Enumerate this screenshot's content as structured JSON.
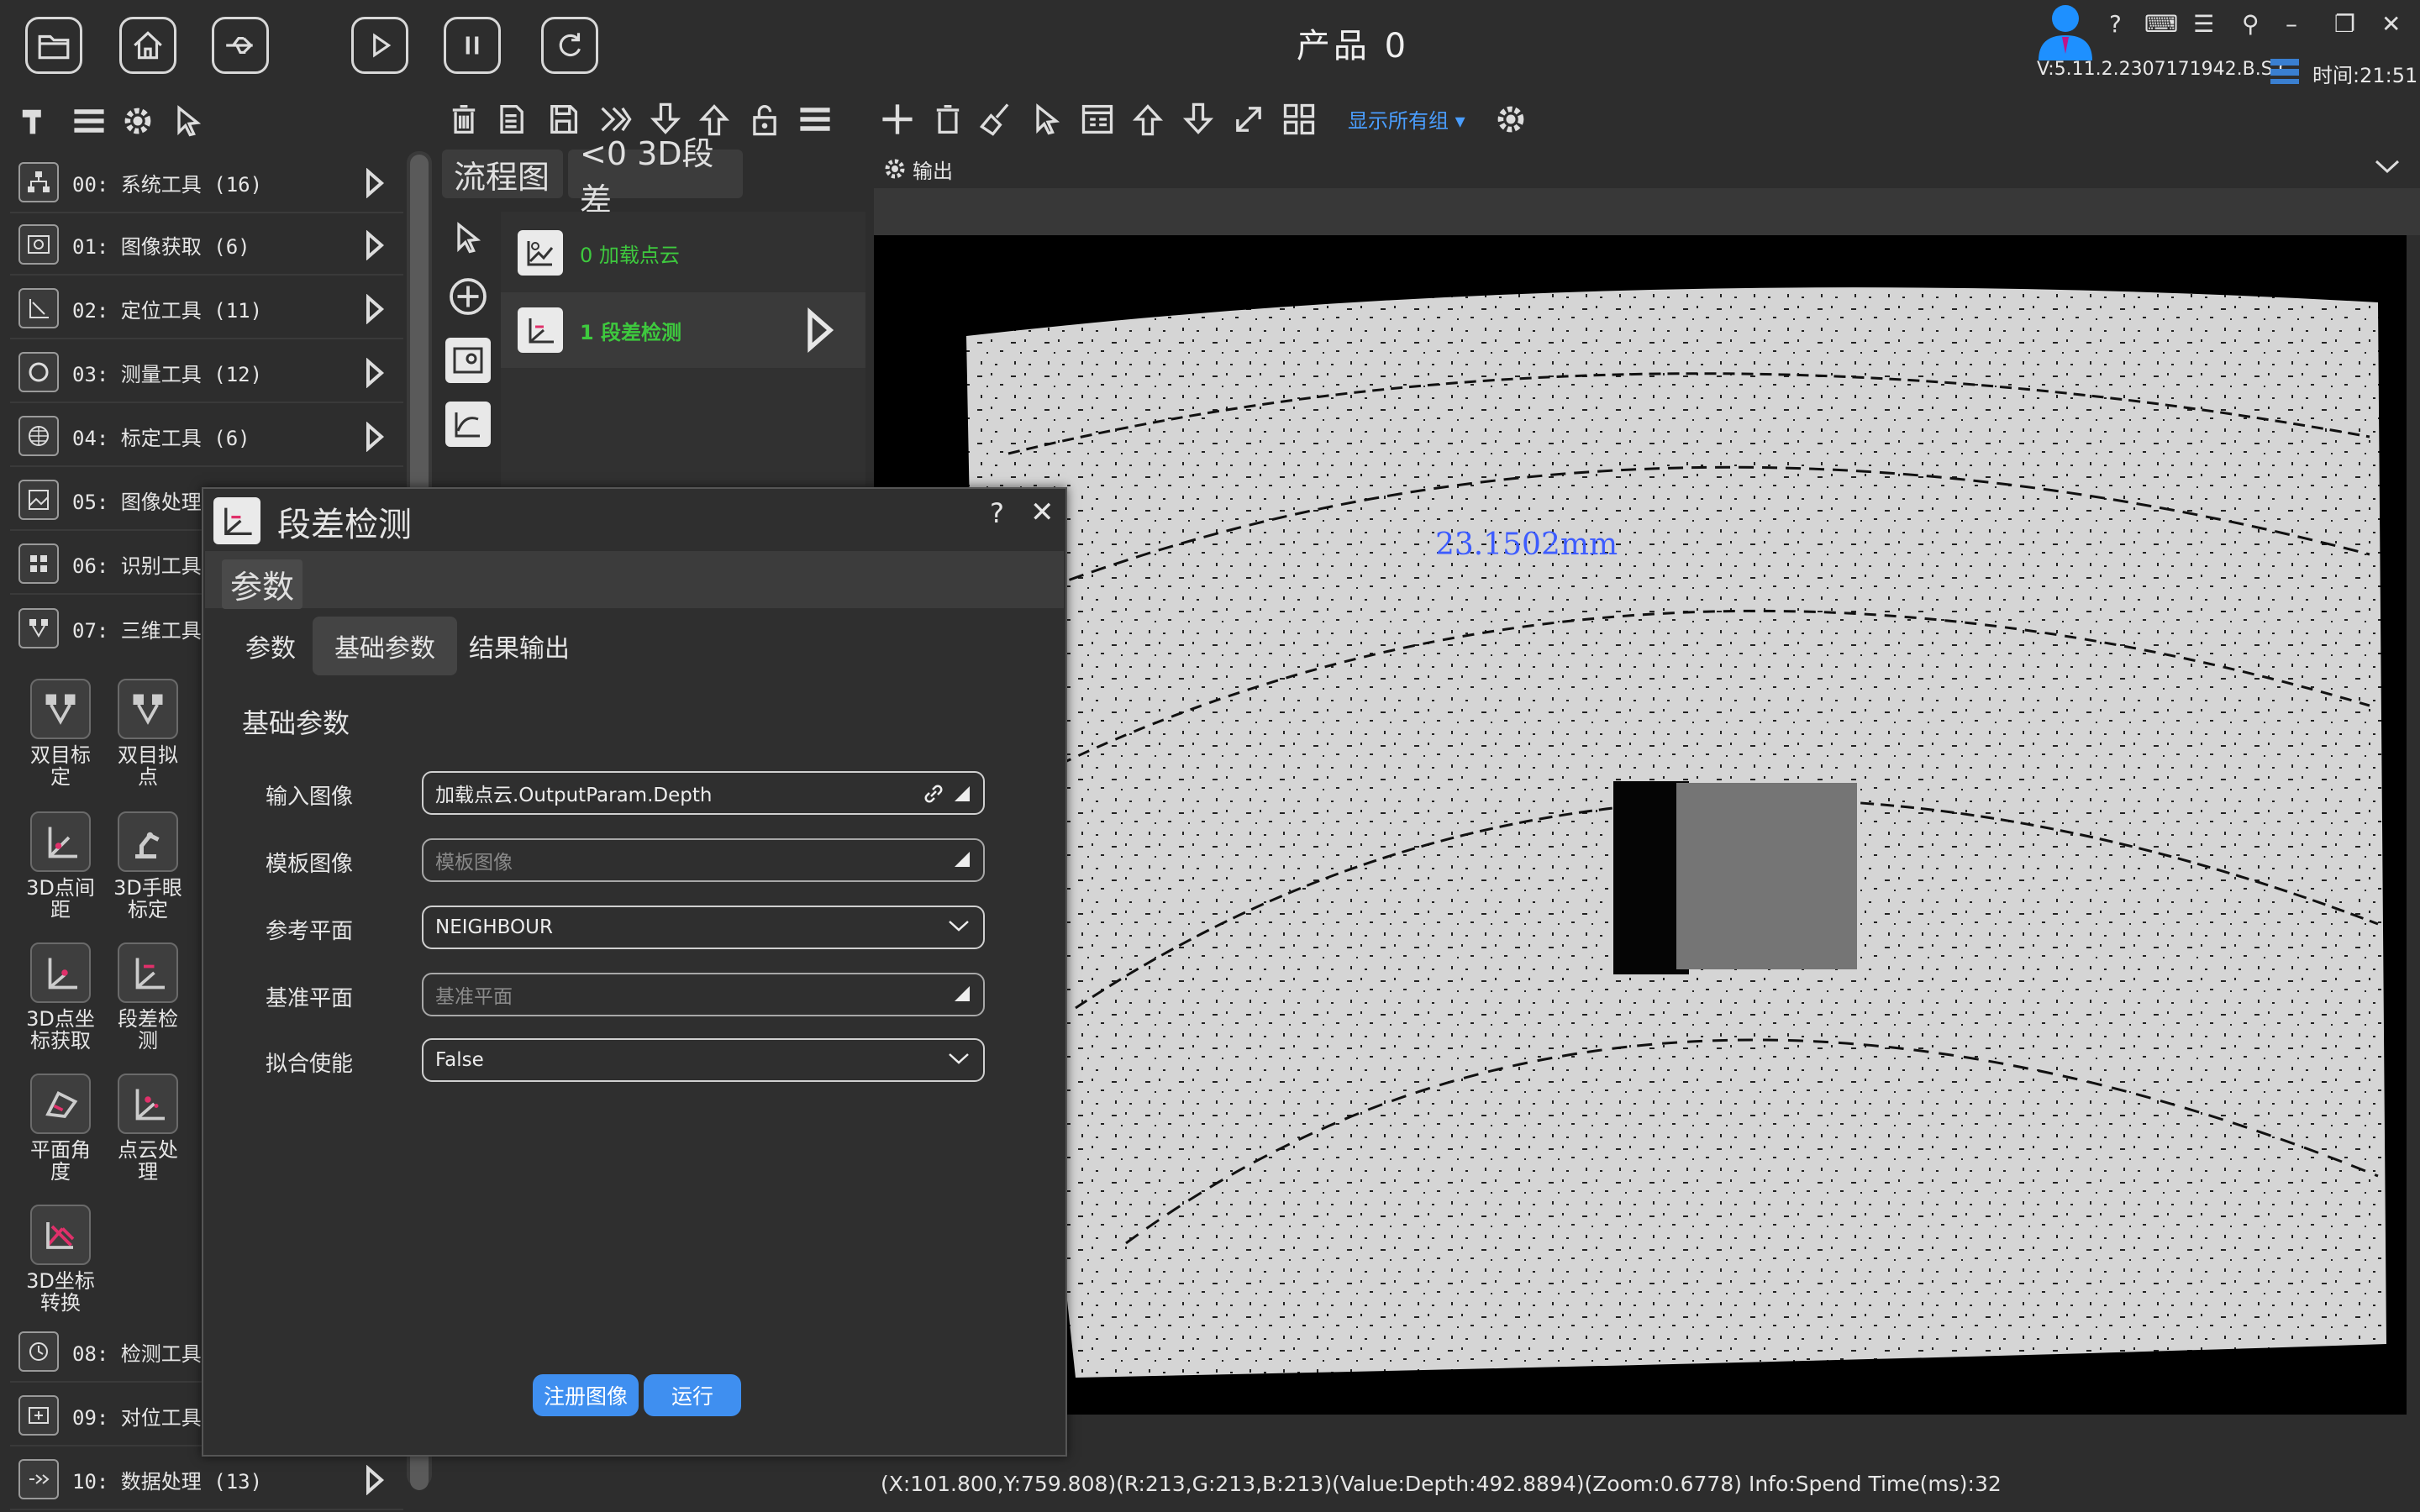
{
  "titlebar": {
    "product_title": "产品 0",
    "version": "V:5.11.2.2307171942.B.S.C.",
    "time": "时间:21:51"
  },
  "toolbar": {
    "show_groups": "显示所有组"
  },
  "categories": [
    {
      "label": "00: 系统工具 (16)",
      "icon": "sitemap-icon"
    },
    {
      "label": "01: 图像获取 (6)",
      "icon": "image-acquire-icon"
    },
    {
      "label": "02: 定位工具 (11)",
      "icon": "locate-icon"
    },
    {
      "label": "03: 测量工具 (12)",
      "icon": "measure-circle-icon"
    },
    {
      "label": "04: 标定工具 (6)",
      "icon": "grid-globe-icon"
    },
    {
      "label": "05: 图像处理",
      "icon": "image-process-icon"
    },
    {
      "label": "06: 识别工具",
      "icon": "recognize-icon"
    },
    {
      "label": "07: 三维工具",
      "icon": "three-d-icon"
    },
    {
      "label": "08: 检测工具",
      "icon": "clock-detect-icon"
    },
    {
      "label": "09: 对位工具",
      "icon": "align-icon"
    },
    {
      "label": "10: 数据处理 (13)",
      "icon": "data-process-icon"
    }
  ],
  "tiles": [
    {
      "label1": "双目标",
      "label2": "定"
    },
    {
      "label1": "双目拟",
      "label2": "点"
    },
    {
      "label1": "3D点间",
      "label2": "距"
    },
    {
      "label1": "3D手眼",
      "label2": "标定"
    },
    {
      "label1": "3D点坐",
      "label2": "标获取"
    },
    {
      "label1": "段差检",
      "label2": "测"
    },
    {
      "label1": "平面角",
      "label2": "度"
    },
    {
      "label1": "点云处",
      "label2": "理"
    },
    {
      "label1": "3D坐标",
      "label2": "转换"
    }
  ],
  "flow": {
    "tab_main": "流程图",
    "tab_sub": "<0 3D段差",
    "nodes": [
      {
        "label": "0 加载点云"
      },
      {
        "label": "1 段差检测"
      }
    ]
  },
  "output": {
    "title": "输出",
    "measurement": "23.1502mm",
    "status": "(X:101.800,Y:759.808)(R:213,G:213,B:213)(Value:Depth:492.8894)(Zoom:0.6778)  Info:Spend Time(ms):32"
  },
  "dialog": {
    "title": "段差检测",
    "help": "?",
    "close": "✕",
    "section": "参数",
    "tabs": [
      "参数",
      "基础参数",
      "结果输出"
    ],
    "group_title": "基础参数",
    "params": [
      {
        "label": "输入图像",
        "value": "加载点云.OutputParam.Depth"
      },
      {
        "label": "模板图像",
        "placeholder": "模板图像"
      },
      {
        "label": "参考平面",
        "value": "NEIGHBOUR"
      },
      {
        "label": "基准平面",
        "placeholder": "基准平面"
      },
      {
        "label": "拟合使能",
        "value": "False"
      }
    ],
    "register_button": "注册图像",
    "run_button": "运行"
  },
  "colors": {
    "background": "#2d2d2d",
    "accent": "#3f8ff0",
    "flow_text": "#3ec93e",
    "measurement": "#3d5cff"
  }
}
